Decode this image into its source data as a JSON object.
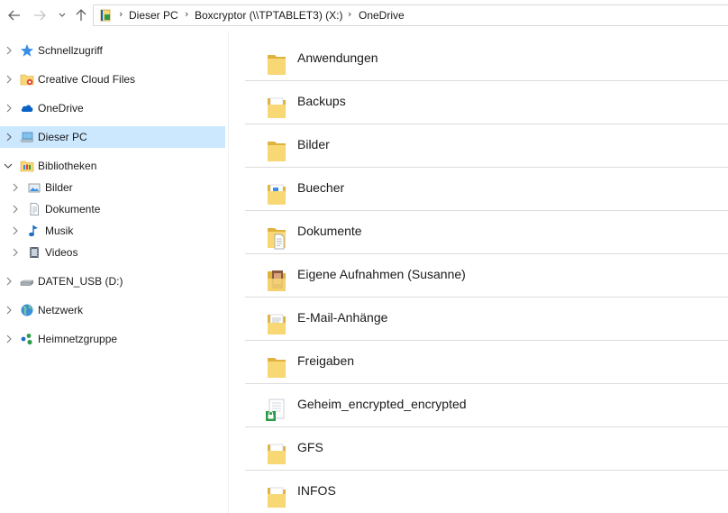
{
  "toolbar": {
    "back": "back-arrow-icon",
    "forward": "forward-arrow-icon",
    "recent": "chevron-down-icon",
    "up": "up-arrow-icon"
  },
  "breadcrumb": {
    "items": [
      "Dieser PC",
      "Boxcryptor (\\\\TPTABLET3) (X:)",
      "OneDrive"
    ]
  },
  "navpane": {
    "items": [
      {
        "label": "Schnellzugriff",
        "icon": "star-icon"
      },
      {
        "label": "Creative Cloud Files",
        "icon": "creative-cloud-folder-icon"
      },
      {
        "label": "OneDrive",
        "icon": "cloud-icon"
      },
      {
        "label": "Dieser PC",
        "icon": "computer-icon"
      },
      {
        "label": "Bibliotheken",
        "icon": "libraries-folder-icon"
      },
      {
        "label": "Bilder",
        "icon": "pictures-library-icon"
      },
      {
        "label": "Dokumente",
        "icon": "documents-library-icon"
      },
      {
        "label": "Musik",
        "icon": "music-library-icon"
      },
      {
        "label": "Videos",
        "icon": "videos-library-icon"
      },
      {
        "label": "DATEN_USB (D:)",
        "icon": "usb-drive-icon"
      },
      {
        "label": "Netzwerk",
        "icon": "network-icon"
      },
      {
        "label": "Heimnetzgruppe",
        "icon": "homegroup-icon"
      }
    ],
    "selected": "Dieser PC"
  },
  "content": {
    "folders": [
      {
        "name": "Anwendungen",
        "icon": "folder-icon"
      },
      {
        "name": "Backups",
        "icon": "folder-with-files-icon"
      },
      {
        "name": "Bilder",
        "icon": "folder-icon"
      },
      {
        "name": "Buecher",
        "icon": "folder-with-files-icon"
      },
      {
        "name": "Dokumente",
        "icon": "folder-with-document-icon"
      },
      {
        "name": "Eigene Aufnahmen (Susanne)",
        "icon": "folder-with-photo-icon"
      },
      {
        "name": "E-Mail-Anhänge",
        "icon": "folder-with-files-icon"
      },
      {
        "name": "Freigaben",
        "icon": "folder-icon"
      },
      {
        "name": "Geheim_encrypted_encrypted",
        "icon": "encrypted-folder-icon"
      },
      {
        "name": "GFS",
        "icon": "folder-with-files-icon"
      },
      {
        "name": "INFOS",
        "icon": "folder-with-files-icon"
      }
    ]
  },
  "colors": {
    "selection": "#cce8ff",
    "folder_yellow": "#f8d775",
    "folder_dark": "#e0b23e",
    "divider": "#dcdcdc",
    "onedrive_blue": "#0a62c4",
    "boxcryptor_green": "#2e9b4a"
  }
}
